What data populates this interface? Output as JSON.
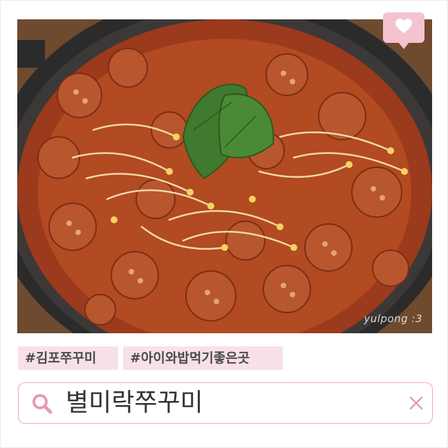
{
  "colors": {
    "accent_pink": "#f4c3cf",
    "tag_background": "#f8e1e6",
    "search_border": "#f0a7b8",
    "icon_pink": "#e79aae",
    "text_dark": "#333333"
  },
  "photo": {
    "watermark": "yulpong :3"
  },
  "heart_bubble": {
    "icon": "heart-icon"
  },
  "tags": [
    {
      "label": "#김포쭈꾸미"
    },
    {
      "label": "#아이와밥먹기좋은곳"
    }
  ],
  "search": {
    "value": "별미락쭈꾸미",
    "search_icon": "search-icon",
    "clear_icon": "close-icon"
  }
}
